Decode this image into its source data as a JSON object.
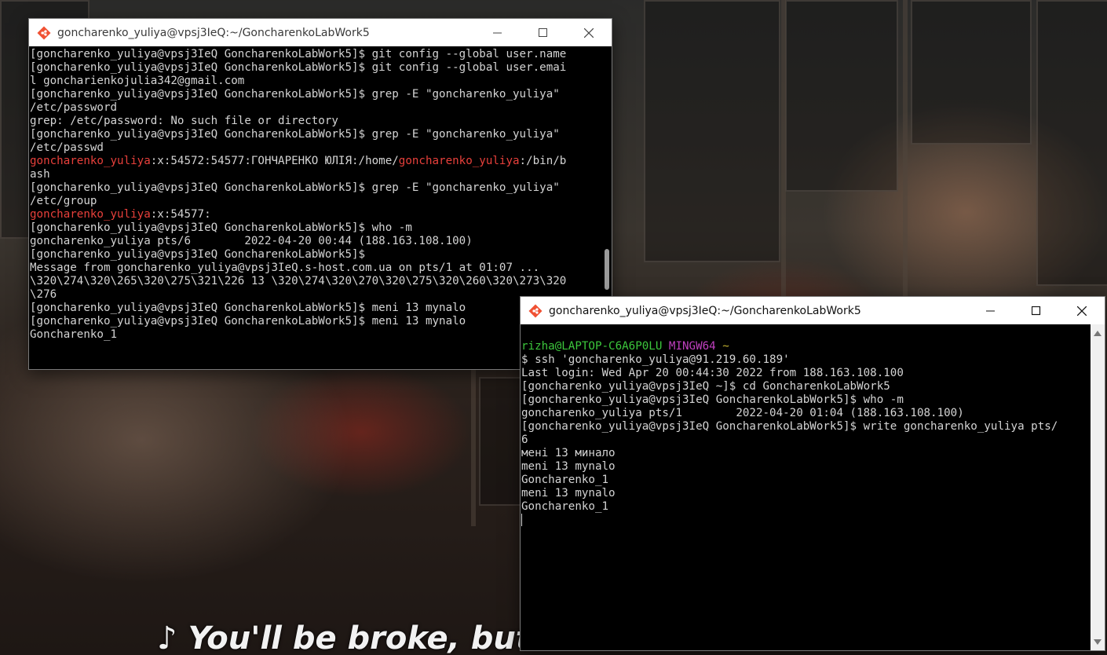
{
  "video": {
    "caption": "♪ You'll be broke, but I'll be broke... ♪"
  },
  "window1": {
    "title": "goncharenko_yuliya@vpsj3IeQ:~/GoncharenkoLabWork5",
    "lines": [
      [
        {
          "t": "[goncharenko_yuliya@vpsj3IeQ GoncharenkoLabWork5]$ git config --global user.name"
        }
      ],
      [
        {
          "t": "[goncharenko_yuliya@vpsj3IeQ GoncharenkoLabWork5]$ git config --global user.emai"
        }
      ],
      [
        {
          "t": "l gonchar​ienkojulia342@gmail.com"
        }
      ],
      [
        {
          "t": "[goncharenko_yuliya@vpsj3IeQ GoncharenkoLabWork5]$ grep -E \"goncharenko_yuliya\""
        }
      ],
      [
        {
          "t": "/etc/password"
        }
      ],
      [
        {
          "t": "grep: /etc/password: No such file or directory"
        }
      ],
      [
        {
          "t": "[goncharenko_yuliya@vpsj3IeQ GoncharenkoLabWork5]$ grep -E \"goncharenko_yuliya\""
        }
      ],
      [
        {
          "t": "/etc/passwd"
        }
      ],
      [
        {
          "t": "goncharenko_yuliya",
          "c": "red"
        },
        {
          "t": ":x:54572:54577:ГОНЧАРЕНКО ЮЛІЯ:/home/"
        },
        {
          "t": "goncharenko_yuliya",
          "c": "red"
        },
        {
          "t": ":/bin/b"
        }
      ],
      [
        {
          "t": "ash"
        }
      ],
      [
        {
          "t": "[goncharenko_yuliya@vpsj3IeQ GoncharenkoLabWork5]$ grep -E \"goncharenko_yuliya\""
        }
      ],
      [
        {
          "t": "/etc/group"
        }
      ],
      [
        {
          "t": "goncharenko_yuliya",
          "c": "red"
        },
        {
          "t": ":x:54577:"
        }
      ],
      [
        {
          "t": "[goncharenko_yuliya@vpsj3IeQ GoncharenkoLabWork5]$ who -m"
        }
      ],
      [
        {
          "t": "goncharenko_yuliya pts/6        2022-04-20 00:44 (188.163.108.100)"
        }
      ],
      [
        {
          "t": "[goncharenko_yuliya@vpsj3IeQ GoncharenkoLabWork5]$"
        }
      ],
      [
        {
          "t": "Message from goncharenko_yuliya@vpsj3IeQ.s-host.com.ua on pts/1 at 01:07 ..."
        }
      ],
      [
        {
          "t": "\\320\\274\\320\\265\\320\\275\\321\\226 13 \\320\\274\\320\\270\\320\\275\\320\\260\\320\\273\\320"
        }
      ],
      [
        {
          "t": "\\276"
        }
      ],
      [
        {
          "t": "[goncharenko_yuliya@vpsj3IeQ GoncharenkoLabWork5]$ meni 13 mynalo"
        }
      ],
      [
        {
          "t": "[goncharenko_yuliya@vpsj3IeQ GoncharenkoLabWork5]$ meni 13 mynalo"
        }
      ],
      [
        {
          "t": "Goncharenko_1"
        }
      ]
    ]
  },
  "window2": {
    "title": "goncharenko_yuliya@vpsj3IeQ:~/GoncharenkoLabWork5",
    "lines": [
      [
        {
          "t": "rizha@LAPTOP-C6A6P0LU ",
          "c": "green"
        },
        {
          "t": "MINGW64",
          "c": "magenta"
        },
        {
          "t": " ~",
          "c": "yellow"
        }
      ],
      [
        {
          "t": "$ ssh 'goncharenko_yuliya@91.219.60.189'"
        }
      ],
      [
        {
          "t": "Last login: Wed Apr 20 00:44:30 2022 from 188.163.108.100"
        }
      ],
      [
        {
          "t": "[goncharenko_yuliya@vpsj3IeQ ~]$ cd GoncharenkoLabWork5"
        }
      ],
      [
        {
          "t": "[goncharenko_yuliya@vpsj3IeQ GoncharenkoLabWork5]$ who -m"
        }
      ],
      [
        {
          "t": "goncharenko_yuliya pts/1        2022-04-20 01:04 (188.163.108.100)"
        }
      ],
      [
        {
          "t": "[goncharenko_yuliya@vpsj3IeQ GoncharenkoLabWork5]$ write goncharenko_yuliya pts/"
        }
      ],
      [
        {
          "t": "6"
        }
      ],
      [
        {
          "t": "мені 13 минало"
        }
      ],
      [
        {
          "t": "meni 13 mynalo"
        }
      ],
      [
        {
          "t": "Goncharenko_1"
        }
      ],
      [
        {
          "t": "meni 13 mynalo"
        }
      ],
      [
        {
          "t": "Goncharenko_1"
        }
      ],
      [
        {
          "t": ""
        }
      ]
    ]
  },
  "colors": {
    "prompt_user": "#3cc73c",
    "prompt_env": "#c040c0",
    "prompt_path": "#c0b030",
    "grep_match": "#e8403b"
  }
}
